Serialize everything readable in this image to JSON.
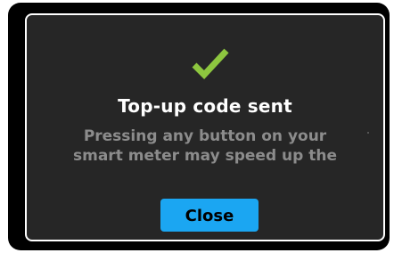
{
  "dialog": {
    "icon": "checkmark-icon",
    "title": "Top-up code sent",
    "message_lines": [
      "Pressing any button on your",
      "smart meter may speed up the"
    ],
    "close_label": "Close"
  },
  "colors": {
    "screen_background": "#000000",
    "dialog_background": "#262626",
    "dialog_border": "#ffffff",
    "check": "#8dc63f",
    "title_text": "#ffffff",
    "message_text": "#8c8c8c",
    "button_background": "#1ba6f2",
    "button_text": "#000000"
  }
}
